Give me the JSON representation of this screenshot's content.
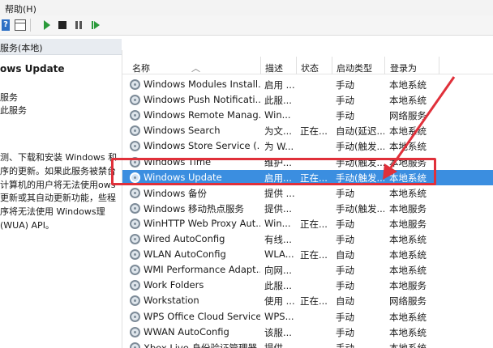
{
  "menubar": {
    "help_label": "帮助(H)"
  },
  "toolbar": {
    "help_icon_glyph": "?"
  },
  "left_panel": {
    "header": "服务(本地)",
    "title": "ows Update",
    "link_start": "服务",
    "link_restart": "此服务",
    "description": "测、下载和安装 Windows 和序的更新。如果此服务被禁台计算机的用户将无法使用ows 更新或其自动更新功能，些程序将无法使用 Windows理(WUA) API。"
  },
  "columns": {
    "name": "名称",
    "description": "描述",
    "status": "状态",
    "startup": "启动类型",
    "logon": "登录为"
  },
  "services": [
    {
      "name": "Windows Modules Install...",
      "desc": "启用 ...",
      "status": "",
      "startup": "手动",
      "logon": "本地系统"
    },
    {
      "name": "Windows Push Notificati...",
      "desc": "此服...",
      "status": "",
      "startup": "手动",
      "logon": "本地系统"
    },
    {
      "name": "Windows Remote Manag...",
      "desc": "Win...",
      "status": "",
      "startup": "手动",
      "logon": "网络服务"
    },
    {
      "name": "Windows Search",
      "desc": "为文...",
      "status": "正在...",
      "startup": "自动(延迟...",
      "logon": "本地系统"
    },
    {
      "name": "Windows Store Service (...",
      "desc": "为 W...",
      "status": "",
      "startup": "手动(触发...",
      "logon": "本地系统"
    },
    {
      "name": "Windows Time",
      "desc": "维护...",
      "status": "",
      "startup": "手动(触发...",
      "logon": "本地服务"
    },
    {
      "name": "Windows Update",
      "desc": "启用...",
      "status": "正在...",
      "startup": "手动(触发...",
      "logon": "本地系统"
    },
    {
      "name": "Windows 备份",
      "desc": "提供 ...",
      "status": "",
      "startup": "手动",
      "logon": "本地系统"
    },
    {
      "name": "Windows 移动热点服务",
      "desc": "提供...",
      "status": "",
      "startup": "手动(触发...",
      "logon": "本地服务"
    },
    {
      "name": "WinHTTP Web Proxy Aut...",
      "desc": "Win...",
      "status": "正在...",
      "startup": "手动",
      "logon": "本地服务"
    },
    {
      "name": "Wired AutoConfig",
      "desc": "有线...",
      "status": "",
      "startup": "手动",
      "logon": "本地系统"
    },
    {
      "name": "WLAN AutoConfig",
      "desc": "WLA...",
      "status": "正在...",
      "startup": "自动",
      "logon": "本地系统"
    },
    {
      "name": "WMI Performance Adapt...",
      "desc": "向网...",
      "status": "",
      "startup": "手动",
      "logon": "本地系统"
    },
    {
      "name": "Work Folders",
      "desc": "此服...",
      "status": "",
      "startup": "手动",
      "logon": "本地服务"
    },
    {
      "name": "Workstation",
      "desc": "使用 ...",
      "status": "正在...",
      "startup": "自动",
      "logon": "网络服务"
    },
    {
      "name": "WPS Office Cloud Service",
      "desc": "WPS...",
      "status": "",
      "startup": "手动",
      "logon": "本地系统"
    },
    {
      "name": "WWAN AutoConfig",
      "desc": "该服...",
      "status": "",
      "startup": "手动",
      "logon": "本地系统"
    },
    {
      "name": "Xbox Live 身份验证管理器",
      "desc": "提供...",
      "status": "",
      "startup": "手动",
      "logon": "本地系统"
    }
  ],
  "colors": {
    "selection": "#3b8ee0",
    "highlight_box": "#e0303a",
    "arrow": "#e0303a"
  }
}
